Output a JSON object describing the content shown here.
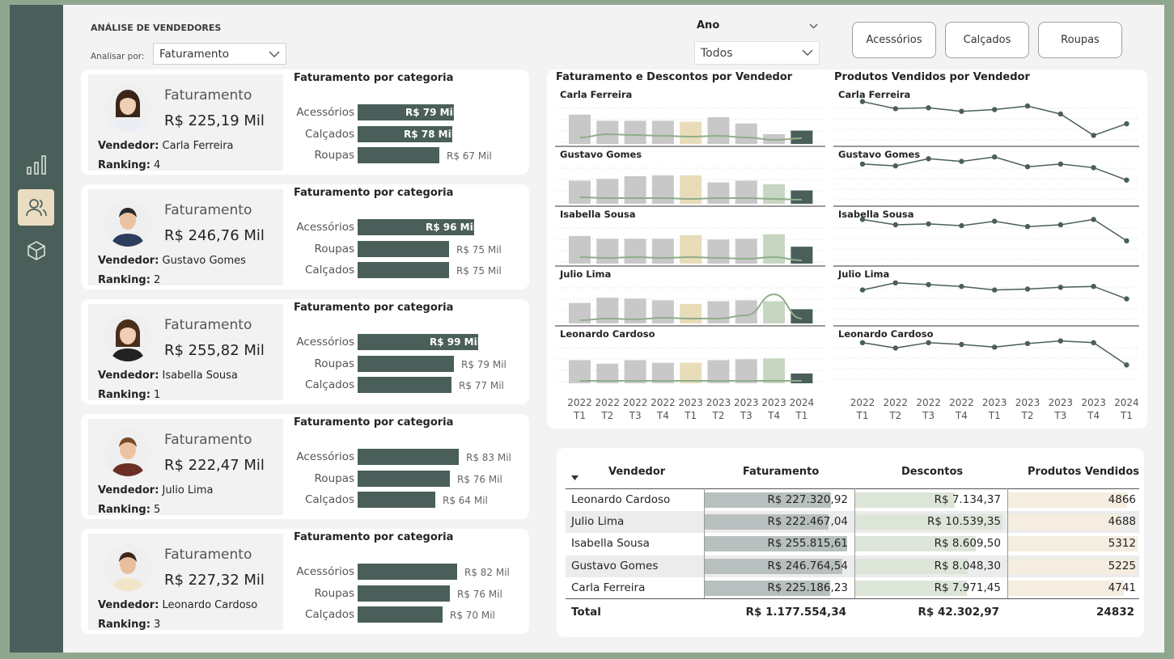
{
  "header": {
    "title": "ANÁLISE DE VENDEDORES",
    "analyze_label": "Analisar por:",
    "analyze_value": "Faturamento"
  },
  "year_filter": {
    "title": "Ano",
    "value": "Todos"
  },
  "category_buttons": [
    "Acessórios",
    "Calçados",
    "Roupas"
  ],
  "sidebar": {
    "items": [
      {
        "icon": "bar-chart-icon",
        "active": false
      },
      {
        "icon": "users-icon",
        "active": true
      },
      {
        "icon": "box-icon",
        "active": false
      }
    ]
  },
  "colors": {
    "dark": "#4a5f5a",
    "gray_bar": "#c8c8c8",
    "beige_bar": "#e8dcb9",
    "green_bar": "#c7d6c2",
    "line": "#8fae8a"
  },
  "cards": [
    {
      "metric": "Faturamento",
      "value": "R$ 225,19 Mil",
      "seller_label": "Vendedor:",
      "seller": "Carla Ferreira",
      "rank_label": "Ranking:",
      "rank": "4",
      "chart_title": "Faturamento por categoria",
      "bars": [
        {
          "label": "Acessórios",
          "value": 79,
          "text": "R$ 79 Mil"
        },
        {
          "label": "Calçados",
          "value": 78,
          "text": "R$ 78 Mil"
        },
        {
          "label": "Roupas",
          "value": 67,
          "text": "R$ 67 Mil"
        }
      ]
    },
    {
      "metric": "Faturamento",
      "value": "R$ 246,76 Mil",
      "seller_label": "Vendedor:",
      "seller": "Gustavo Gomes",
      "rank_label": "Ranking:",
      "rank": "2",
      "chart_title": "Faturamento por categoria",
      "bars": [
        {
          "label": "Acessórios",
          "value": 96,
          "text": "R$ 96 Mil"
        },
        {
          "label": "Roupas",
          "value": 75,
          "text": "R$ 75 Mil"
        },
        {
          "label": "Calçados",
          "value": 75,
          "text": "R$ 75 Mil"
        }
      ]
    },
    {
      "metric": "Faturamento",
      "value": "R$ 255,82 Mil",
      "seller_label": "Vendedor:",
      "seller": "Isabella Sousa",
      "rank_label": "Ranking:",
      "rank": "1",
      "chart_title": "Faturamento por categoria",
      "bars": [
        {
          "label": "Acessórios",
          "value": 99,
          "text": "R$ 99 Mil"
        },
        {
          "label": "Roupas",
          "value": 79,
          "text": "R$ 79 Mil"
        },
        {
          "label": "Calçados",
          "value": 77,
          "text": "R$ 77 Mil"
        }
      ]
    },
    {
      "metric": "Faturamento",
      "value": "R$ 222,47 Mil",
      "seller_label": "Vendedor:",
      "seller": "Julio Lima",
      "rank_label": "Ranking:",
      "rank": "5",
      "chart_title": "Faturamento por categoria",
      "bars": [
        {
          "label": "Acessórios",
          "value": 83,
          "text": "R$ 83 Mil"
        },
        {
          "label": "Roupas",
          "value": 76,
          "text": "R$ 76 Mil"
        },
        {
          "label": "Calçados",
          "value": 64,
          "text": "R$ 64 Mil"
        }
      ]
    },
    {
      "metric": "Faturamento",
      "value": "R$ 227,32 Mil",
      "seller_label": "Vendedor:",
      "seller": "Leonardo Cardoso",
      "rank_label": "Ranking:",
      "rank": "3",
      "chart_title": "Faturamento por categoria",
      "bars": [
        {
          "label": "Acessórios",
          "value": 82,
          "text": "R$ 82 Mil"
        },
        {
          "label": "Roupas",
          "value": 76,
          "text": "R$ 76 Mil"
        },
        {
          "label": "Calçados",
          "value": 70,
          "text": "R$ 70 Mil"
        }
      ]
    }
  ],
  "chart_data": [
    {
      "type": "bar",
      "title": "Faturamento e Descontos por Vendedor",
      "x": [
        [
          "2022",
          "T1"
        ],
        [
          "2022",
          "T2"
        ],
        [
          "2022",
          "T3"
        ],
        [
          "2022",
          "T4"
        ],
        [
          "2023",
          "T1"
        ],
        [
          "2023",
          "T2"
        ],
        [
          "2023",
          "T3"
        ],
        [
          "2023",
          "T4"
        ],
        [
          "2024",
          "T1"
        ]
      ],
      "panels": [
        {
          "name": "Carla Ferreira",
          "bars": [
            33,
            26,
            26,
            26,
            25,
            30,
            23,
            11,
            15
          ],
          "line": [
            8,
            12,
            11,
            10,
            9,
            10,
            8,
            5,
            7
          ]
        },
        {
          "name": "Gustavo Gomes",
          "bars": [
            26,
            28,
            31,
            32,
            32,
            24,
            26,
            22,
            15
          ],
          "line": [
            8,
            7,
            7,
            7,
            6,
            7,
            7,
            6,
            5
          ]
        },
        {
          "name": "Isabella Sousa",
          "bars": [
            31,
            28,
            28,
            28,
            32,
            27,
            28,
            33,
            19
          ],
          "line": [
            8,
            7,
            8,
            7,
            8,
            7,
            6,
            8,
            4
          ]
        },
        {
          "name": "Julio Lima",
          "bars": [
            23,
            29,
            28,
            26,
            22,
            25,
            26,
            25,
            16
          ],
          "line": [
            4,
            6,
            5,
            7,
            6,
            6,
            10,
            36,
            6
          ]
        },
        {
          "name": "Leonardo Cardoso",
          "bars": [
            26,
            22,
            26,
            23,
            23,
            26,
            27,
            28,
            11
          ],
          "line": [
            3,
            3,
            3,
            3,
            3,
            3,
            3,
            3,
            3
          ]
        }
      ]
    },
    {
      "type": "line",
      "title": "Produtos Vendidos por Vendedor",
      "x": [
        [
          "2022",
          "T1"
        ],
        [
          "2022",
          "T2"
        ],
        [
          "2022",
          "T3"
        ],
        [
          "2022",
          "T4"
        ],
        [
          "2023",
          "T1"
        ],
        [
          "2023",
          "T2"
        ],
        [
          "2023",
          "T3"
        ],
        [
          "2023",
          "T4"
        ],
        [
          "2024",
          "T1"
        ]
      ],
      "panels": [
        {
          "name": "Carla Ferreira",
          "values": [
            640,
            560,
            570,
            530,
            550,
            590,
            500,
            260,
            390
          ]
        },
        {
          "name": "Gustavo Gomes",
          "values": [
            610,
            590,
            670,
            640,
            690,
            580,
            610,
            570,
            430
          ]
        },
        {
          "name": "Isabella Sousa",
          "values": [
            660,
            600,
            610,
            590,
            640,
            580,
            600,
            660,
            420
          ]
        },
        {
          "name": "Julio Lima",
          "values": [
            540,
            620,
            600,
            580,
            540,
            550,
            570,
            580,
            440
          ]
        },
        {
          "name": "Leonardo Cardoso",
          "values": [
            620,
            560,
            620,
            600,
            570,
            610,
            640,
            620,
            370
          ]
        }
      ]
    }
  ],
  "table": {
    "headers": [
      "Vendedor",
      "Faturamento",
      "Descontos",
      "Produtos Vendidos"
    ],
    "rows": [
      {
        "vendedor": "Leonardo Cardoso",
        "fat": "R$ 227.320,92",
        "fat_v": 227320.92,
        "desc": "R$ 7.134,37",
        "desc_v": 7134.37,
        "prod": "4866",
        "prod_v": 4866
      },
      {
        "vendedor": "Julio Lima",
        "fat": "R$ 222.467,04",
        "fat_v": 222467.04,
        "desc": "R$ 10.539,35",
        "desc_v": 10539.35,
        "prod": "4688",
        "prod_v": 4688
      },
      {
        "vendedor": "Isabella Sousa",
        "fat": "R$ 255.815,61",
        "fat_v": 255815.61,
        "desc": "R$ 8.609,50",
        "desc_v": 8609.5,
        "prod": "5312",
        "prod_v": 5312
      },
      {
        "vendedor": "Gustavo Gomes",
        "fat": "R$ 246.764,54",
        "fat_v": 246764.54,
        "desc": "R$ 8.048,30",
        "desc_v": 8048.3,
        "prod": "5225",
        "prod_v": 5225
      },
      {
        "vendedor": "Carla Ferreira",
        "fat": "R$ 225.186,23",
        "fat_v": 225186.23,
        "desc": "R$ 7.971,45",
        "desc_v": 7971.45,
        "prod": "4741",
        "prod_v": 4741
      }
    ],
    "total": {
      "label": "Total",
      "fat": "R$ 1.177.554,34",
      "desc": "R$ 42.302,97",
      "prod": "24832"
    }
  }
}
